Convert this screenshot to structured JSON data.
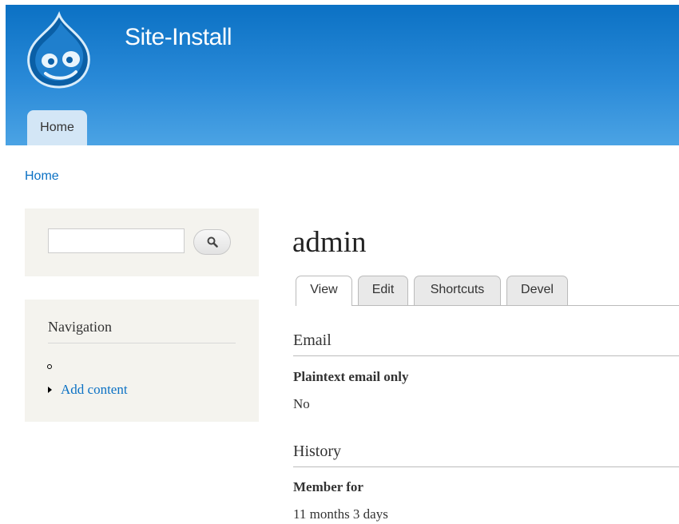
{
  "site": {
    "name": "Site-Install"
  },
  "header_nav": {
    "home_tab": "Home"
  },
  "breadcrumb": {
    "home": "Home"
  },
  "search": {
    "value": "",
    "placeholder": ""
  },
  "navigation": {
    "title": "Navigation",
    "items": [
      {
        "label": "Add content"
      }
    ]
  },
  "page": {
    "title": "admin",
    "tabs": [
      {
        "label": "View",
        "active": true
      },
      {
        "label": "Edit",
        "active": false
      },
      {
        "label": "Shortcuts",
        "active": false
      },
      {
        "label": "Devel",
        "active": false
      }
    ]
  },
  "sections": [
    {
      "heading": "Email",
      "field_label": "Plaintext email only",
      "field_value": "No"
    },
    {
      "heading": "History",
      "field_label": "Member for",
      "field_value": "11 months 3 days"
    }
  ],
  "colors": {
    "header_top": "#0b71c4",
    "header_bottom": "#4ba3e4",
    "link": "#0b71c4",
    "sidebar_bg": "#f4f3ee"
  },
  "icons": {
    "logo": "drupal-drop-logo-icon",
    "search": "magnifier-icon"
  }
}
